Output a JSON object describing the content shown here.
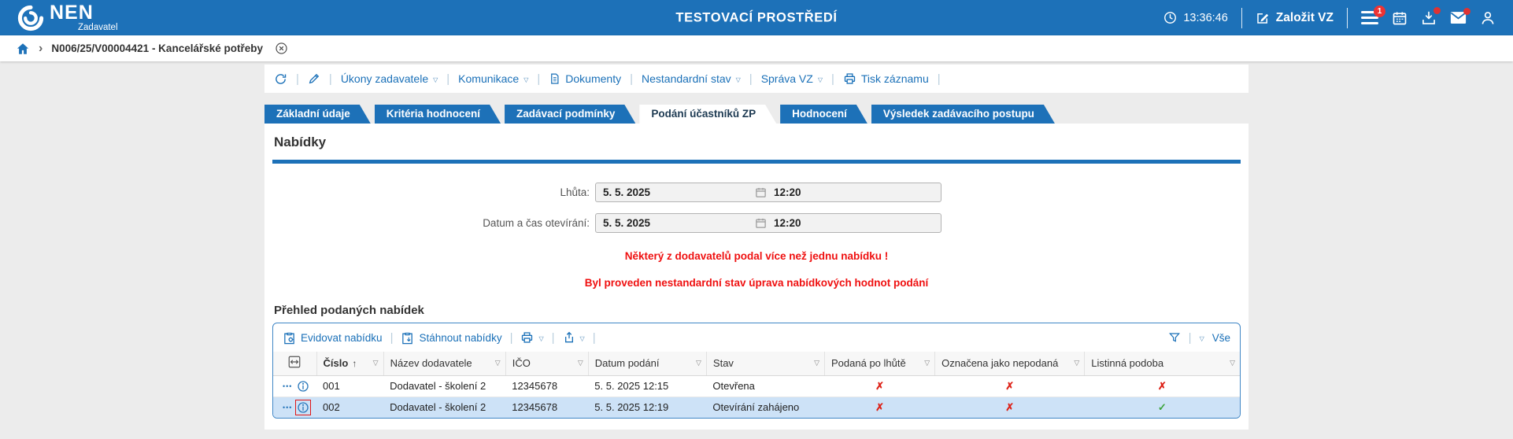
{
  "topbar": {
    "logo_text": "NEN",
    "logo_subtitle": "Zadavatel",
    "title": "TESTOVACÍ PROSTŘEDÍ",
    "time": "13:36:46",
    "create_button": "Založit VZ",
    "menu_badge": "1"
  },
  "breadcrumb": {
    "item": "N006/25/V00004421 - Kancelářské potřeby"
  },
  "toolbar": {
    "items": [
      {
        "label": "Úkony zadavatele"
      },
      {
        "label": "Komunikace"
      },
      {
        "label": "Dokumenty"
      },
      {
        "label": "Nestandardní stav"
      },
      {
        "label": "Správa VZ"
      },
      {
        "label": "Tisk záznamu"
      }
    ]
  },
  "tabs": [
    {
      "label": "Základní údaje",
      "active": false
    },
    {
      "label": "Kritéria hodnocení",
      "active": false
    },
    {
      "label": "Zadávací podmínky",
      "active": false
    },
    {
      "label": "Podání účastníků ZP",
      "active": true
    },
    {
      "label": "Hodnocení",
      "active": false
    },
    {
      "label": "Výsledek zadávacího postupu",
      "active": false
    }
  ],
  "section": {
    "title": "Nabídky"
  },
  "form": {
    "fields": [
      {
        "label": "Lhůta:",
        "date": "5. 5. 2025",
        "time": "12:20"
      },
      {
        "label": "Datum a čas otevírání:",
        "date": "5. 5. 2025",
        "time": "12:20"
      }
    ]
  },
  "warnings": [
    "Některý z dodavatelů podal více než jednu nabídku !",
    "Byl proveden nestandardní stav úprava nabídkových hodnot podání"
  ],
  "offers": {
    "title": "Přehled podaných nabídek",
    "actions": [
      {
        "label": "Evidovat nabídku"
      },
      {
        "label": "Stáhnout nabídky"
      }
    ],
    "filter_all_label": "Vše",
    "columns": [
      "Číslo",
      "Název dodavatele",
      "IČO",
      "Datum podání",
      "Stav",
      "Podaná po lhůtě",
      "Označena jako nepodaná",
      "Listinná podoba"
    ],
    "rows": [
      {
        "cislo": "001",
        "nazev": "Dodavatel - školení 2",
        "ico": "12345678",
        "datum": "5. 5. 2025 12:15",
        "stav": "Otevřena",
        "po_lhute": "✗",
        "nepodana": "✗",
        "listinna": "✗"
      },
      {
        "cislo": "002",
        "nazev": "Dodavatel - školení 2",
        "ico": "12345678",
        "datum": "5. 5. 2025 12:19",
        "stav": "Otevírání zahájeno",
        "po_lhute": "✗",
        "nepodana": "✗",
        "listinna": "✓"
      }
    ]
  }
}
